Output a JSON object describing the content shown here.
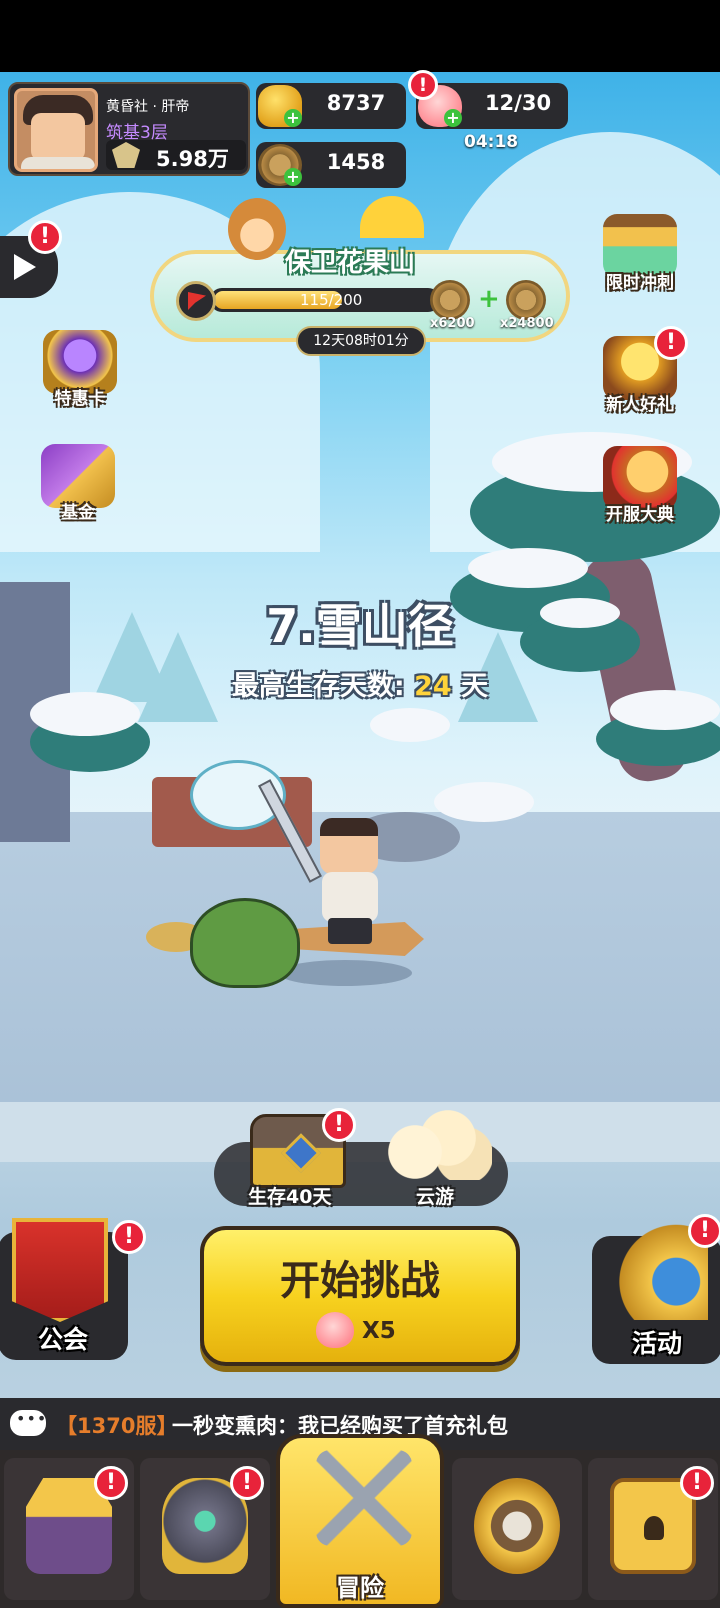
{
  "player": {
    "name": "黄昏社 · 肝帝",
    "rank": "筑基3层",
    "power": "5.98万"
  },
  "resources": {
    "gold": "8737",
    "coins": "1458",
    "stamina": "12/30",
    "stamina_timer": "04:18"
  },
  "event": {
    "title": "保卫花果山",
    "progress_text": "115/200",
    "progress_fraction": 0.575,
    "reward1": "x6200",
    "reward2": "x24800",
    "time_left": "12天08时01分"
  },
  "left_buttons": [
    {
      "label": "特惠卡",
      "icon": "vip-card-icon"
    },
    {
      "label": "基金",
      "icon": "fund-icon"
    }
  ],
  "right_buttons": [
    {
      "label": "限时冲刺",
      "icon": "hourglass-icon"
    },
    {
      "label": "新人好礼",
      "icon": "gift-icon"
    },
    {
      "label": "开服大典",
      "icon": "drum-icon"
    }
  ],
  "stage": {
    "title": "7.雪山径",
    "best_label": "最高生存天数:",
    "best_days": "24",
    "unit": "天"
  },
  "chest": {
    "label": "生存40天"
  },
  "cloud": {
    "label": "云游"
  },
  "start": {
    "label": "开始挑战",
    "cost": "X5"
  },
  "guild": {
    "label": "公会"
  },
  "activity": {
    "label": "活动"
  },
  "chat": {
    "server": "【1370服】",
    "message": "一秒变熏肉：我已经购买了首充礼包"
  },
  "nav": {
    "active_label": "冒险"
  },
  "badge": "!",
  "colors": {
    "accent": "#f7d21f",
    "badge": "#e8233a",
    "rank_purple": "#c58bff"
  }
}
